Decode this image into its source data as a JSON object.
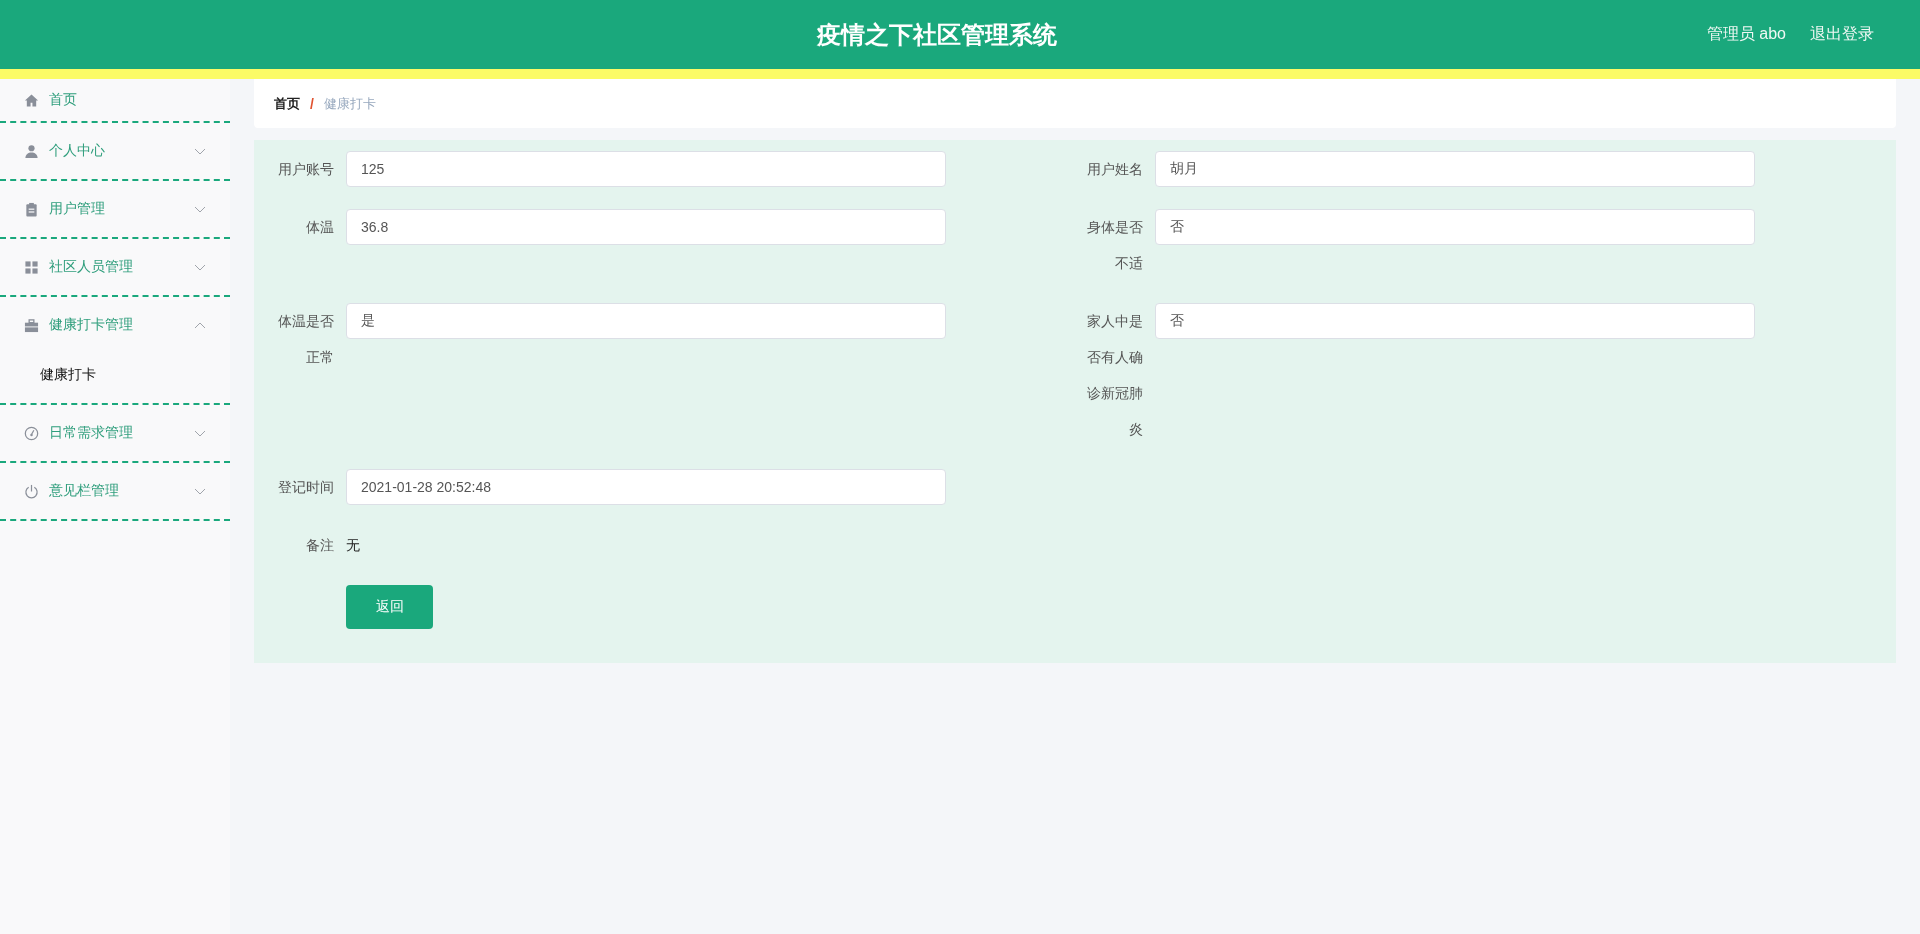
{
  "header": {
    "title": "疫情之下社区管理系统",
    "user": "管理员 abo",
    "logout": "退出登录"
  },
  "sidebar": {
    "items": [
      {
        "label": "首页",
        "kind": "link",
        "selected": false
      },
      {
        "label": "个人中心",
        "kind": "submenu",
        "expanded": false
      },
      {
        "label": "用户管理",
        "kind": "submenu",
        "expanded": false
      },
      {
        "label": "社区人员管理",
        "kind": "submenu",
        "expanded": false
      },
      {
        "label": "健康打卡管理",
        "kind": "submenu",
        "expanded": true,
        "children": [
          {
            "label": "健康打卡",
            "selected": true
          }
        ]
      },
      {
        "label": "日常需求管理",
        "kind": "submenu",
        "expanded": false
      },
      {
        "label": "意见栏管理",
        "kind": "submenu",
        "expanded": false
      }
    ]
  },
  "breadcrumb": {
    "separator": "/",
    "items": [
      {
        "label": "首页",
        "current": false
      },
      {
        "label": "健康打卡",
        "current": true
      }
    ]
  },
  "form": {
    "fields": [
      {
        "label": "用户账号",
        "kind": "input",
        "value": "125"
      },
      {
        "label": "用户姓名",
        "kind": "input",
        "value": "胡月"
      },
      {
        "label": "体温",
        "kind": "input",
        "value": "36.8"
      },
      {
        "label": "身体是否不适",
        "kind": "input",
        "value": "否"
      },
      {
        "label": "体温是否正常",
        "kind": "input",
        "value": "是"
      },
      {
        "label": "家人中是否有人确诊新冠肺炎",
        "kind": "input",
        "value": "否"
      },
      {
        "label": "登记时间",
        "kind": "input",
        "value": "2021-01-28 20:52:48"
      },
      {
        "label": "备注",
        "kind": "text",
        "value": "无"
      }
    ],
    "buttons": [
      {
        "label": "返回"
      }
    ]
  }
}
